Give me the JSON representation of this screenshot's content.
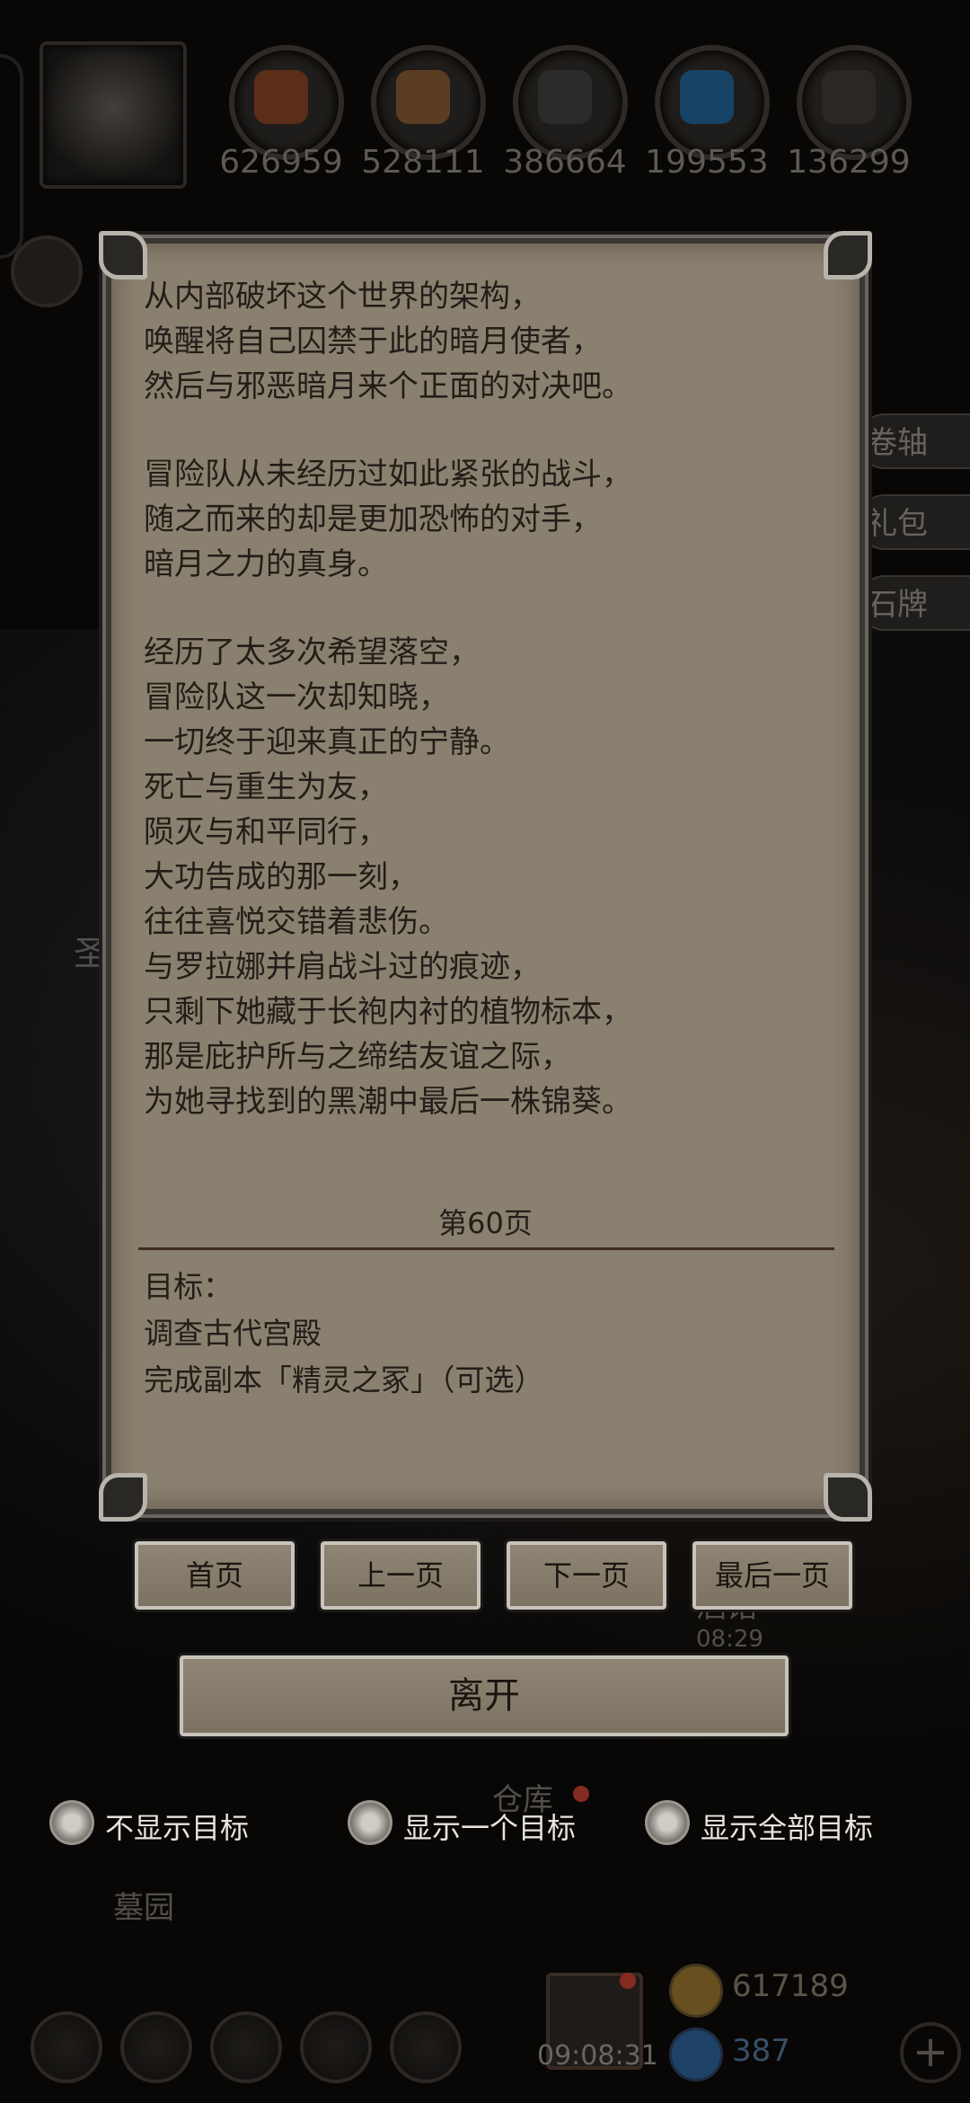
{
  "hud": {
    "resources": [
      {
        "name": "ore",
        "value": "626959",
        "color": "#a0522d"
      },
      {
        "name": "wood",
        "value": "528111",
        "color": "#a06a3a"
      },
      {
        "name": "iron",
        "value": "386664",
        "color": "#55524d"
      },
      {
        "name": "crystal",
        "value": "199553",
        "color": "#2f7ab0"
      },
      {
        "name": "stone",
        "value": "136299",
        "color": "#4a4744"
      }
    ],
    "side_tabs": [
      "卷轴",
      "礼包",
      "石牌"
    ],
    "left_label": "圣",
    "tavern_label": "酒馆",
    "tavern_time": "08:29",
    "warehouse_label": "仓库",
    "graveyard_label": "墓园",
    "clock": "09:08:31",
    "gold": "617189",
    "gems": "387"
  },
  "book": {
    "stanzas": [
      [
        "从内部破坏这个世界的架构，",
        "唤醒将自己囚禁于此的暗月使者，",
        "然后与邪恶暗月来个正面的对决吧。"
      ],
      [
        "冒险队从未经历过如此紧张的战斗，",
        "随之而来的却是更加恐怖的对手，",
        "暗月之力的真身。"
      ],
      [
        "经历了太多次希望落空，",
        "冒险队这一次却知晓，",
        "一切终于迎来真正的宁静。",
        "死亡与重生为友，",
        "陨灭与和平同行，",
        "大功告成的那一刻，",
        "往往喜悦交错着悲伤。",
        "与罗拉娜并肩战斗过的痕迹，",
        "只剩下她藏于长袍内衬的植物标本，",
        "那是庇护所与之缔结友谊之际，",
        "为她寻找到的黑潮中最后一株锦葵。"
      ]
    ],
    "page_label": "第60页",
    "objectives_title": "目标：",
    "objectives": [
      "调查古代宫殿",
      "完成副本「精灵之冢」（可选）"
    ]
  },
  "nav": {
    "first": "首页",
    "prev": "上一页",
    "next": "下一页",
    "last": "最后一页",
    "leave": "离开"
  },
  "objective_display": {
    "options": [
      "不显示目标",
      "显示一个目标",
      "显示全部目标"
    ]
  }
}
